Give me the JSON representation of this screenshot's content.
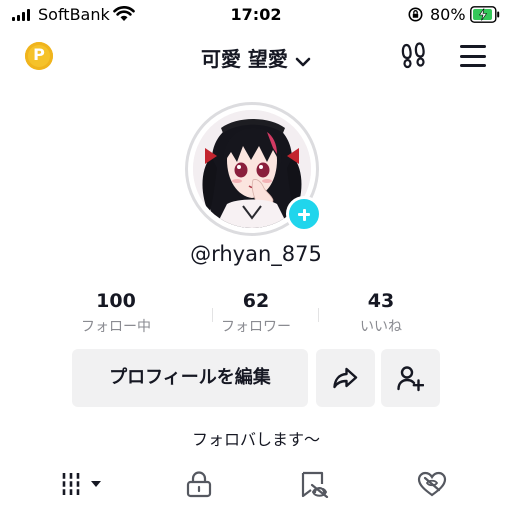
{
  "status_bar": {
    "carrier": "SoftBank",
    "time": "17:02",
    "battery_percent": "80%",
    "icons": [
      "signal-icon",
      "wifi-icon",
      "orientation-lock-icon",
      "battery-charging-icon"
    ]
  },
  "header": {
    "coin_label": "P",
    "display_name": "可愛 望愛",
    "icons": [
      "coin-icon",
      "chevron-down-icon",
      "footprint-icon",
      "menu-icon"
    ]
  },
  "profile": {
    "handle": "@rhyan_875",
    "bio": "フォロバします〜",
    "colors": {
      "add_badge": "#20d5ec",
      "coin": "#f5c22a"
    }
  },
  "stats": [
    {
      "value": "100",
      "label": "フォロー中"
    },
    {
      "value": "62",
      "label": "フォロワー"
    },
    {
      "value": "43",
      "label": "いいね"
    }
  ],
  "actions": {
    "edit_profile": "プロフィールを編集",
    "icons": [
      "share-icon",
      "add-friend-icon"
    ]
  },
  "tabs": {
    "icons": [
      "videos-grid-icon",
      "private-lock-icon",
      "saved-icon",
      "liked-icon"
    ]
  }
}
